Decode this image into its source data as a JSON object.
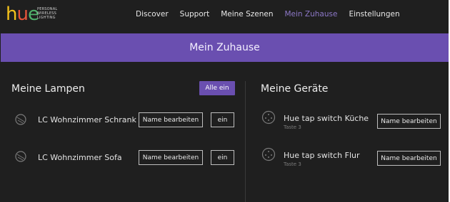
{
  "logo": {
    "word": [
      "h",
      "u",
      "e"
    ],
    "tagline": [
      "PERSONAL",
      "WIRELESS",
      "LIGHTING"
    ]
  },
  "nav": [
    {
      "label": "Discover"
    },
    {
      "label": "Support"
    },
    {
      "label": "Meine Szenen"
    },
    {
      "label": "Mein Zuhause"
    },
    {
      "label": "Einstellungen"
    }
  ],
  "nav_active": "Mein Zuhause",
  "banner": {
    "title": "Mein Zuhause"
  },
  "lamps": {
    "title": "Meine Lampen",
    "all_on_label": "Alle ein",
    "items": [
      {
        "name": "LC Wohnzimmer Schrank",
        "edit_label": "Name bearbeiten",
        "on_label": "ein",
        "icon": "lamp-icon"
      },
      {
        "name": "LC Wohnzimmer Sofa",
        "edit_label": "Name bearbeiten",
        "on_label": "ein",
        "icon": "lamp-icon"
      }
    ]
  },
  "devices": {
    "title": "Meine Geräte",
    "items": [
      {
        "name": "Hue tap switch Küche",
        "sub": "Taste 3",
        "edit_label": "Name bearbeiten",
        "icon": "tap-switch-icon"
      },
      {
        "name": "Hue tap switch Flur",
        "sub": "Taste 3",
        "edit_label": "Name bearbeiten",
        "icon": "tap-switch-icon"
      }
    ]
  },
  "colors": {
    "accent": "#6a4fb0",
    "background": "#1f1f1f",
    "nav_active": "#8d78c8"
  }
}
